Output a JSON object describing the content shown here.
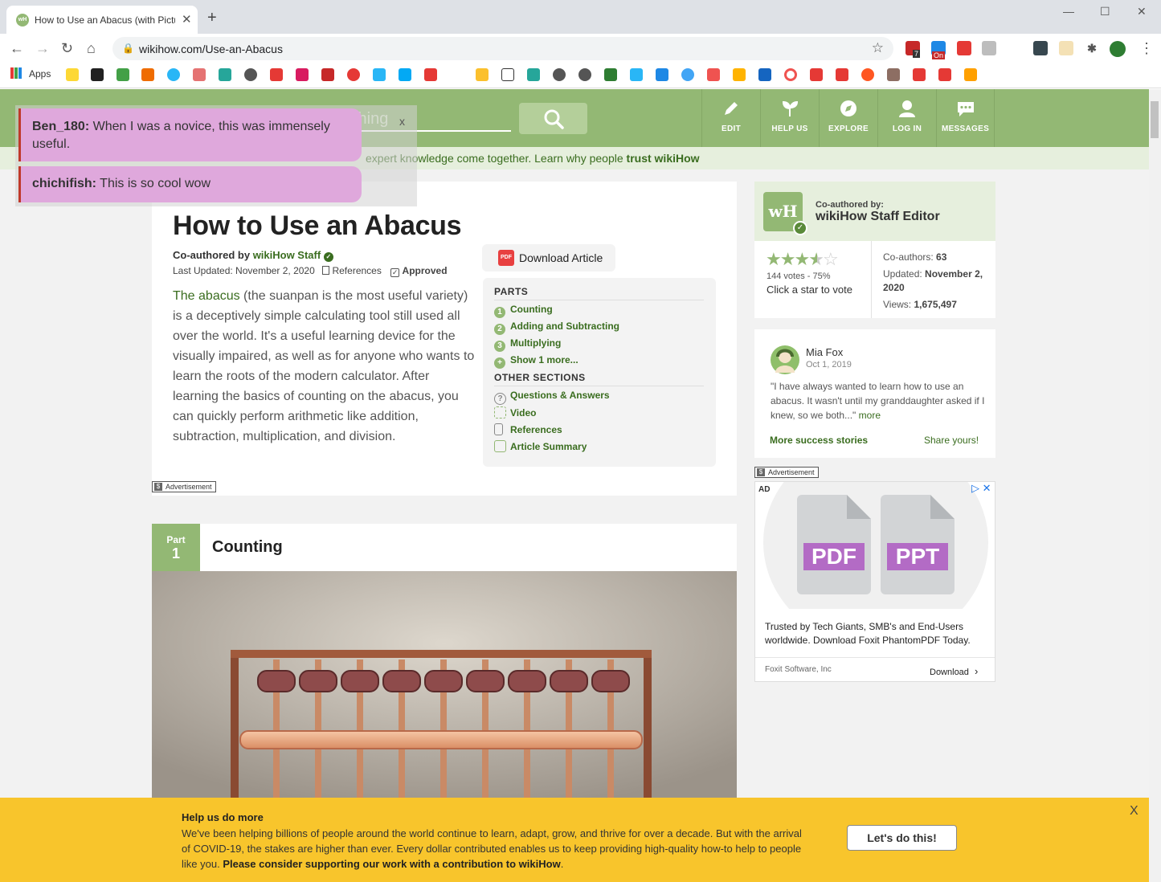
{
  "browser": {
    "tab_title": "How to Use an Abacus (with Pictures)",
    "url": "wikihow.com/Use-an-Abacus",
    "apps_label": "Apps",
    "favicon_text": "wH",
    "extension_badges": {
      "ext1": "7",
      "ext2": "On"
    }
  },
  "site_header": {
    "search_hint": "thing",
    "nav": [
      {
        "label": "EDIT",
        "icon": "pencil-icon"
      },
      {
        "label": "HELP US",
        "icon": "sprout-icon"
      },
      {
        "label": "EXPLORE",
        "icon": "compass-icon"
      },
      {
        "label": "LOG IN",
        "icon": "user-icon"
      },
      {
        "label": "MESSAGES",
        "icon": "chat-icon"
      }
    ],
    "trust_text": "expert knowledge come together. Learn why people",
    "trust_link": "trust wikiHow"
  },
  "comments": [
    {
      "user": "Ben_180:",
      "text": "When I was a novice, this was immensely useful."
    },
    {
      "user": "chichifish:",
      "text": "This is so cool wow"
    }
  ],
  "comments_close": "x",
  "article": {
    "title": "How to Use an Abacus",
    "coauthored_prefix": "Co-authored by",
    "coauthored_name": "wikiHow Staff",
    "last_updated": "Last Updated: November 2, 2020",
    "references_label": "References",
    "approved_label": "Approved",
    "intro_link": "The abacus",
    "intro_text": " (the suanpan is the most useful variety) is a deceptively simple calculating tool still used all over the world. It's a useful learning device for the visually impaired, as well as for anyone who wants to learn the roots of the modern calculator. After learning the basics of counting on the abacus, you can quickly perform arithmetic like addition, subtraction, multiplication, and division.",
    "download_label": "Download Article",
    "pdf_icon_text": "PDF",
    "ad_label": "Advertisement"
  },
  "toc": {
    "parts_heading": "PARTS",
    "parts": [
      {
        "num": "1",
        "label": "Counting"
      },
      {
        "num": "2",
        "label": "Adding and Subtracting"
      },
      {
        "num": "3",
        "label": "Multiplying"
      },
      {
        "num": "+",
        "label": "Show 1 more..."
      }
    ],
    "other_heading": "OTHER SECTIONS",
    "other": [
      {
        "label": "Questions & Answers",
        "icon": "question-icon"
      },
      {
        "label": "Video",
        "icon": "video-icon"
      },
      {
        "label": "References",
        "icon": "document-icon"
      },
      {
        "label": "Article Summary",
        "icon": "summary-icon"
      }
    ]
  },
  "part1": {
    "part_label": "Part",
    "num": "1",
    "title": "Counting"
  },
  "author_card": {
    "logo_text": "wH",
    "coauthored_label": "Co-authored by:",
    "name": "wikiHow Staff Editor",
    "rating": 3.75,
    "votes": "144 votes - 75%",
    "vote_prompt": "Click a star to vote",
    "coauthors_label": "Co-authors:",
    "coauthors": "63",
    "updated_label": "Updated:",
    "updated": "November 2, 2020",
    "views_label": "Views:",
    "views": "1,675,497"
  },
  "story": {
    "name": "Mia Fox",
    "date": "Oct 1, 2019",
    "quote": "\"I have always wanted to learn how to use an abacus. It wasn't until my granddaughter asked if I knew, so we both...\"",
    "more": "more",
    "more_stories": "More success stories",
    "share": "Share yours!"
  },
  "sidebar_ad": {
    "label": "Advertisement",
    "ad_tag": "AD",
    "close": "✕",
    "doc1": "PDF",
    "doc2": "PPT",
    "text": "Trusted by Tech Giants, SMB's and End-Users worldwide. Download Foxit PhantomPDF Today.",
    "advertiser": "Foxit Software, Inc",
    "cta": "Download"
  },
  "donation": {
    "title": "Help us do more",
    "body": "We've been helping billions of people around the world continue to learn, adapt, grow, and thrive for over a decade. But with the arrival of COVID-19, the stakes are higher than ever. Every dollar contributed enables us to keep providing high-quality how-to help to people like you. ",
    "body_bold": "Please consider supporting our work with a contribution to wikiHow",
    "button": "Let's do this!",
    "close": "X"
  },
  "colors": {
    "brand_green": "#93b874",
    "link_green": "#3a6d1f",
    "banner_yellow": "#f8c52c",
    "comment_pink": "#dfa8dc"
  }
}
